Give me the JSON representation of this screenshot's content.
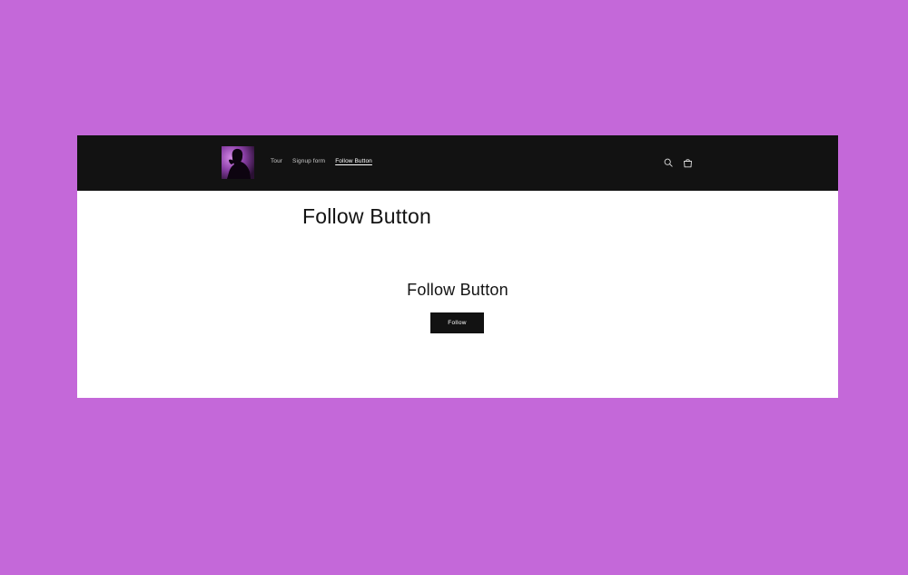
{
  "colors": {
    "background": "#c468d9",
    "header": "#121212",
    "page": "#ffffff",
    "button": "#121212",
    "logo_accent": "#b56ad6"
  },
  "header": {
    "logo_icon": "silhouette-logo",
    "nav": [
      {
        "label": "Tour",
        "active": false
      },
      {
        "label": "Signup form",
        "active": false
      },
      {
        "label": "Follow Button",
        "active": true
      }
    ],
    "icons": [
      "search-icon",
      "cart-icon"
    ]
  },
  "main": {
    "page_title": "Follow Button",
    "section_heading": "Follow Button",
    "follow_button_label": "Follow"
  }
}
